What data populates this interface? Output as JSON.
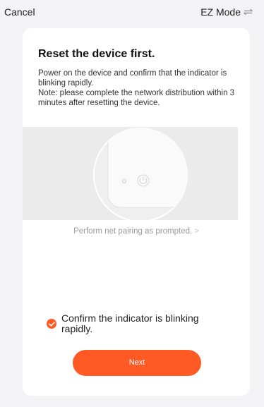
{
  "header": {
    "cancel_label": "Cancel",
    "mode_label": "EZ Mode",
    "mode_icon": "switch-arrows-icon"
  },
  "card": {
    "title": "Reset the device first.",
    "description_line1": "Power on the device and confirm that the indicator is blinking rapidly.",
    "description_line2": "Note: please complete the network distribution within 3 minutes after resetting the device.",
    "illustration_icon": "device-power-button-icon",
    "pairing_link": "Perform net pairing as prompted.",
    "pairing_chevron": ">",
    "confirm_text": "Confirm the indicator is blinking rapidly.",
    "confirm_checked": true,
    "next_label": "Next"
  },
  "colors": {
    "accent": "#ff5a24",
    "background": "#f3f3f5",
    "card": "#ffffff",
    "illustration_bg": "#ebebeb"
  }
}
